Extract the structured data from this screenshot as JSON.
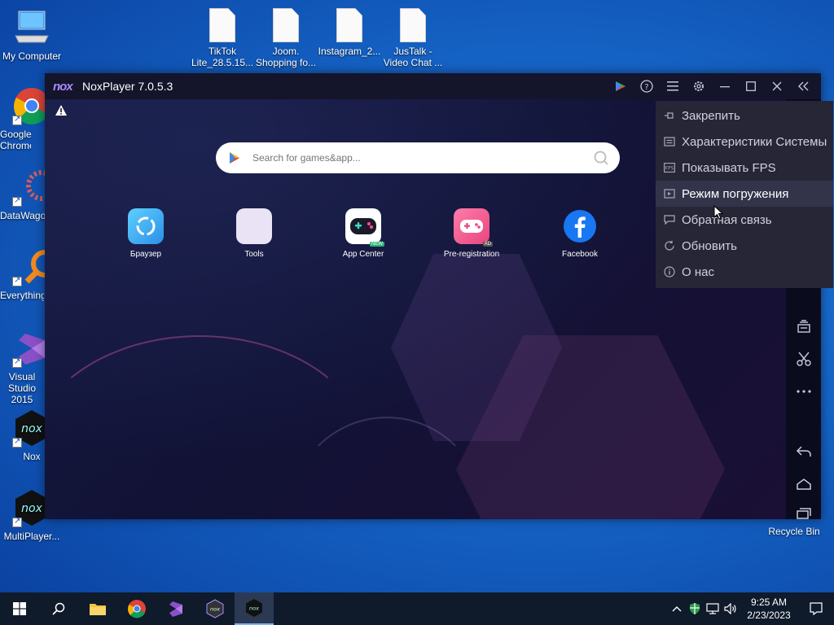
{
  "desktop": {
    "icons": [
      {
        "label": "My Computer"
      },
      {
        "label": "Google Chrome"
      },
      {
        "label": "DataWagon"
      },
      {
        "label": "Everything"
      },
      {
        "label": "Visual Studio 2015"
      },
      {
        "label": "Nox"
      },
      {
        "label": "MultiPlayer..."
      },
      {
        "label": "Recycle Bin"
      }
    ],
    "files": [
      {
        "label": "TikTok Lite_28.5.15..."
      },
      {
        "label": "Joom. Shopping fo..."
      },
      {
        "label": "Instagram_2..."
      },
      {
        "label": "JusTalk - Video Chat ..."
      }
    ]
  },
  "window": {
    "logo": "nox",
    "title": "NoxPlayer 7.0.5.3"
  },
  "search": {
    "placeholder": "Search for games&app..."
  },
  "apps": [
    {
      "label": "Браузер"
    },
    {
      "label": "Tools"
    },
    {
      "label": "App Center",
      "tag": "NEW"
    },
    {
      "label": "Pre-registration",
      "tag": "AD"
    },
    {
      "label": "Facebook"
    }
  ],
  "menu": {
    "items": [
      {
        "label": "Закрепить",
        "icon": "pin-icon"
      },
      {
        "label": "Характеристики Системы",
        "icon": "info-card-icon"
      },
      {
        "label": "Показывать FPS",
        "icon": "fps-icon"
      },
      {
        "label": "Режим погружения",
        "icon": "immersive-icon"
      },
      {
        "label": "Обратная связь",
        "icon": "feedback-icon"
      },
      {
        "label": "Обновить",
        "icon": "refresh-icon"
      },
      {
        "label": "О нас",
        "icon": "about-icon"
      }
    ],
    "hovered_index": 3
  },
  "taskbar": {
    "time": "9:25 AM",
    "date": "2/23/2023"
  },
  "colors": {
    "menu_bg": "#262636",
    "titlebar_bg": "#14142b",
    "desktop_blue": "#1667c9"
  }
}
